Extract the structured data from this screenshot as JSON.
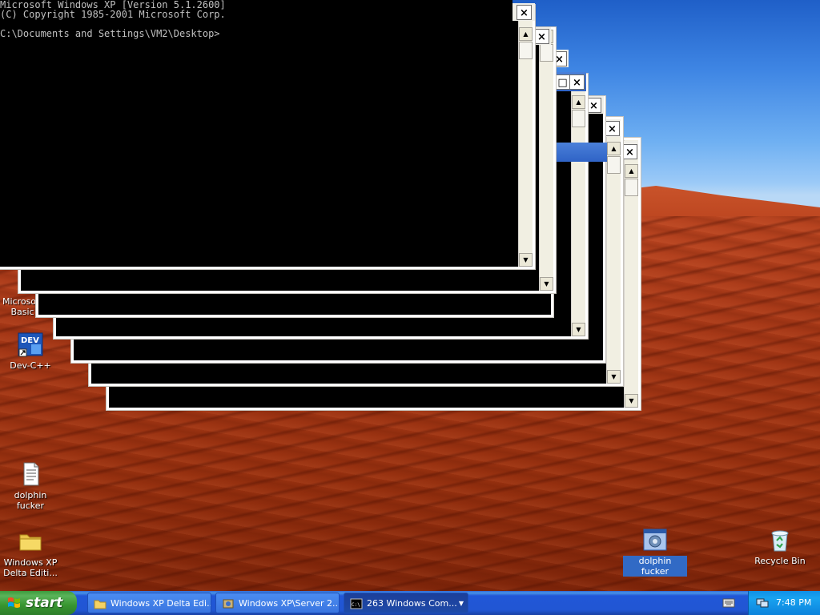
{
  "console": {
    "line1": "Microsoft Windows XP [Version 5.1.2600]",
    "line2": "(C) Copyright 1985-2001 Microsoft Corp.",
    "line3": "",
    "line4": "C:\\Documents and Settings\\VM2\\Desktop>"
  },
  "desktop_icons": {
    "basic": {
      "label_1": "Microsoft",
      "label_2": "Basic"
    },
    "devcpp": {
      "label": "Dev-C++",
      "badge": "DEV"
    },
    "dolphin_doc": {
      "label": "dolphin fucker"
    },
    "winxp_folder": {
      "label_1": "Windows XP",
      "label_2": "Delta Editi..."
    },
    "dolphin_exe": {
      "label": "dolphin fucker"
    },
    "recycle_bin": {
      "label": "Recycle Bin"
    }
  },
  "taskbar": {
    "start_label": "start",
    "buttons": [
      {
        "label": "Windows XP Delta Edi...",
        "icon": "folder-icon"
      },
      {
        "label": "Windows XP\\Server 2...",
        "icon": "setup-icon"
      },
      {
        "label": "263 Windows Com...",
        "icon": "console-icon",
        "badge": "C:\\"
      }
    ],
    "clock": "7:48 PM"
  },
  "window_buttons": {
    "close": "×",
    "minimize": "–",
    "maximize": "□",
    "scroll_up": "▲",
    "scroll_down": "▼"
  }
}
